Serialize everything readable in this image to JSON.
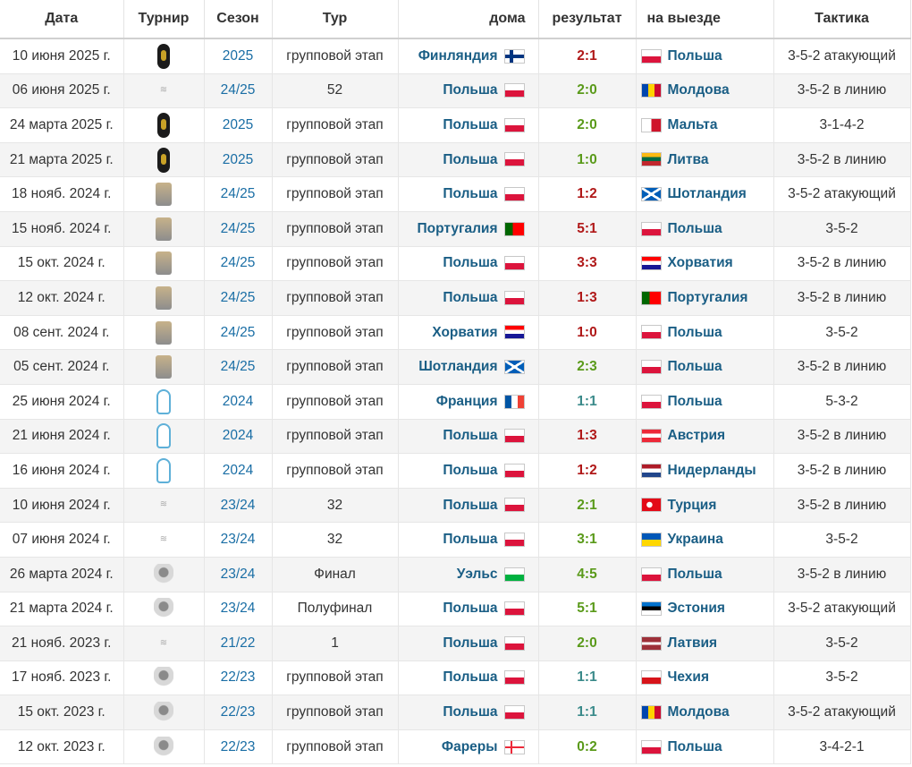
{
  "headers": {
    "date": "Дата",
    "tournament": "Турнир",
    "season": "Сезон",
    "round": "Тур",
    "home": "дома",
    "result": "результат",
    "away": "на выезде",
    "tactic": "Тактика"
  },
  "colors": {
    "team_link": "#1a5e85",
    "season_link": "#1a6ea5",
    "win": "#5a9a1a",
    "loss": "#b01818",
    "draw": "#3a8a8a"
  },
  "rows": [
    {
      "date": "10 июня 2025 г.",
      "icon": "wc",
      "season": "2025",
      "round": "групповой этап",
      "home": "Финляндия",
      "hflag": "fi",
      "score": "2:1",
      "res": "L",
      "away": "Польша",
      "aflag": "pl",
      "tactic": "3-5-2 атакующий"
    },
    {
      "date": "06 июня 2025 г.",
      "icon": "fr",
      "season": "24/25",
      "round": "52",
      "home": "Польша",
      "hflag": "pl",
      "score": "2:0",
      "res": "W",
      "away": "Молдова",
      "aflag": "md",
      "tactic": "3-5-2 в линию"
    },
    {
      "date": "24 марта 2025 г.",
      "icon": "wc",
      "season": "2025",
      "round": "групповой этап",
      "home": "Польша",
      "hflag": "pl",
      "score": "2:0",
      "res": "W",
      "away": "Мальта",
      "aflag": "mt",
      "tactic": "3-1-4-2"
    },
    {
      "date": "21 марта 2025 г.",
      "icon": "wc",
      "season": "2025",
      "round": "групповой этап",
      "home": "Польша",
      "hflag": "pl",
      "score": "1:0",
      "res": "W",
      "away": "Литва",
      "aflag": "lt",
      "tactic": "3-5-2 в линию"
    },
    {
      "date": "18 нояб. 2024 г.",
      "icon": "nl",
      "season": "24/25",
      "round": "групповой этап",
      "home": "Польша",
      "hflag": "pl",
      "score": "1:2",
      "res": "L",
      "away": "Шотландия",
      "aflag": "sc",
      "tactic": "3-5-2 атакующий"
    },
    {
      "date": "15 нояб. 2024 г.",
      "icon": "nl",
      "season": "24/25",
      "round": "групповой этап",
      "home": "Португалия",
      "hflag": "pt",
      "score": "5:1",
      "res": "L",
      "away": "Польша",
      "aflag": "pl",
      "tactic": "3-5-2"
    },
    {
      "date": "15 окт. 2024 г.",
      "icon": "nl",
      "season": "24/25",
      "round": "групповой этап",
      "home": "Польша",
      "hflag": "pl",
      "score": "3:3",
      "res": "L",
      "away": "Хорватия",
      "aflag": "hr",
      "tactic": "3-5-2 в линию"
    },
    {
      "date": "12 окт. 2024 г.",
      "icon": "nl",
      "season": "24/25",
      "round": "групповой этап",
      "home": "Польша",
      "hflag": "pl",
      "score": "1:3",
      "res": "L",
      "away": "Португалия",
      "aflag": "pt",
      "tactic": "3-5-2 в линию"
    },
    {
      "date": "08 сент. 2024 г.",
      "icon": "nl",
      "season": "24/25",
      "round": "групповой этап",
      "home": "Хорватия",
      "hflag": "hr",
      "score": "1:0",
      "res": "L",
      "away": "Польша",
      "aflag": "pl",
      "tactic": "3-5-2"
    },
    {
      "date": "05 сент. 2024 г.",
      "icon": "nl",
      "season": "24/25",
      "round": "групповой этап",
      "home": "Шотландия",
      "hflag": "sc",
      "score": "2:3",
      "res": "W",
      "away": "Польша",
      "aflag": "pl",
      "tactic": "3-5-2 в линию"
    },
    {
      "date": "25 июня 2024 г.",
      "icon": "euro",
      "season": "2024",
      "round": "групповой этап",
      "home": "Франция",
      "hflag": "fr",
      "score": "1:1",
      "res": "D",
      "away": "Польша",
      "aflag": "pl",
      "tactic": "5-3-2"
    },
    {
      "date": "21 июня 2024 г.",
      "icon": "euro",
      "season": "2024",
      "round": "групповой этап",
      "home": "Польша",
      "hflag": "pl",
      "score": "1:3",
      "res": "L",
      "away": "Австрия",
      "aflag": "at",
      "tactic": "3-5-2 в линию"
    },
    {
      "date": "16 июня 2024 г.",
      "icon": "euro",
      "season": "2024",
      "round": "групповой этап",
      "home": "Польша",
      "hflag": "pl",
      "score": "1:2",
      "res": "L",
      "away": "Нидерланды",
      "aflag": "nl",
      "tactic": "3-5-2 в линию"
    },
    {
      "date": "10 июня 2024 г.",
      "icon": "fr",
      "season": "23/24",
      "round": "32",
      "home": "Польша",
      "hflag": "pl",
      "score": "2:1",
      "res": "W",
      "away": "Турция",
      "aflag": "tr",
      "tactic": "3-5-2 в линию"
    },
    {
      "date": "07 июня 2024 г.",
      "icon": "fr",
      "season": "23/24",
      "round": "32",
      "home": "Польша",
      "hflag": "pl",
      "score": "3:1",
      "res": "W",
      "away": "Украина",
      "aflag": "ua",
      "tactic": "3-5-2"
    },
    {
      "date": "26 марта 2024 г.",
      "icon": "q",
      "season": "23/24",
      "round": "Финал",
      "home": "Уэльс",
      "hflag": "wl",
      "score": "4:5",
      "res": "W",
      "away": "Польша",
      "aflag": "pl",
      "tactic": "3-5-2 в линию"
    },
    {
      "date": "21 марта 2024 г.",
      "icon": "q",
      "season": "23/24",
      "round": "Полуфинал",
      "home": "Польша",
      "hflag": "pl",
      "score": "5:1",
      "res": "W",
      "away": "Эстония",
      "aflag": "ee",
      "tactic": "3-5-2 атакующий"
    },
    {
      "date": "21 нояб. 2023 г.",
      "icon": "fr",
      "season": "21/22",
      "round": "1",
      "home": "Польша",
      "hflag": "pl",
      "score": "2:0",
      "res": "W",
      "away": "Латвия",
      "aflag": "lv",
      "tactic": "3-5-2"
    },
    {
      "date": "17 нояб. 2023 г.",
      "icon": "q",
      "season": "22/23",
      "round": "групповой этап",
      "home": "Польша",
      "hflag": "pl",
      "score": "1:1",
      "res": "D",
      "away": "Чехия",
      "aflag": "cz",
      "tactic": "3-5-2"
    },
    {
      "date": "15 окт. 2023 г.",
      "icon": "q",
      "season": "22/23",
      "round": "групповой этап",
      "home": "Польша",
      "hflag": "pl",
      "score": "1:1",
      "res": "D",
      "away": "Молдова",
      "aflag": "md",
      "tactic": "3-5-2 атакующий"
    },
    {
      "date": "12 окт. 2023 г.",
      "icon": "q",
      "season": "22/23",
      "round": "групповой этап",
      "home": "Фареры",
      "hflag": "fo",
      "score": "0:2",
      "res": "W",
      "away": "Польша",
      "aflag": "pl",
      "tactic": "3-4-2-1"
    }
  ]
}
